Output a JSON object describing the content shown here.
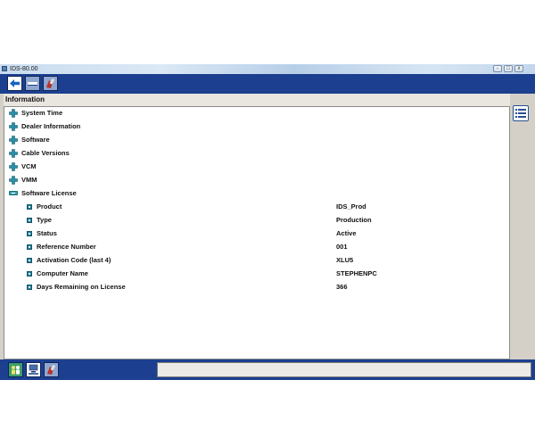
{
  "window": {
    "title": "IDS-80.00",
    "controls": {
      "minimize": "-",
      "maximize": "□",
      "close": "x"
    }
  },
  "toolbar": {
    "buttons": [
      {
        "icon": "back-arrow-icon",
        "state": "active"
      },
      {
        "icon": "vehicle-icon",
        "state": "inactive"
      },
      {
        "icon": "toolbox-icon",
        "state": "inactive"
      }
    ]
  },
  "panel": {
    "title": "Information"
  },
  "tree": {
    "sections": [
      {
        "label": "System Time",
        "expanded": false
      },
      {
        "label": "Dealer Information",
        "expanded": false
      },
      {
        "label": "Software",
        "expanded": false
      },
      {
        "label": "Cable Versions",
        "expanded": false
      },
      {
        "label": "VCM",
        "expanded": false
      },
      {
        "label": "VMM",
        "expanded": false
      },
      {
        "label": "Software License",
        "expanded": true
      }
    ],
    "license_items": [
      {
        "label": "Product",
        "value": "IDS_Prod"
      },
      {
        "label": "Type",
        "value": "Production"
      },
      {
        "label": "Status",
        "value": "Active"
      },
      {
        "label": "Reference Number",
        "value": "001"
      },
      {
        "label": "Activation Code (last 4)",
        "value": "XLU5"
      },
      {
        "label": "Computer Name",
        "value": "STEPHENPC"
      },
      {
        "label": "Days Remaining on License",
        "value": "366"
      }
    ]
  },
  "sidebar": {
    "icon": "list-view-icon"
  },
  "bottombar": {
    "buttons": [
      {
        "icon": "people-icon"
      },
      {
        "icon": "network-icon"
      },
      {
        "icon": "toolbox-icon"
      }
    ],
    "status_text": ""
  },
  "colors": {
    "toolbar_bg": "#1c3f8f",
    "window_bg": "#d4d0c8",
    "plus_icon_fill": "#2a8fa6",
    "accent_arrow": "#1565c0"
  }
}
